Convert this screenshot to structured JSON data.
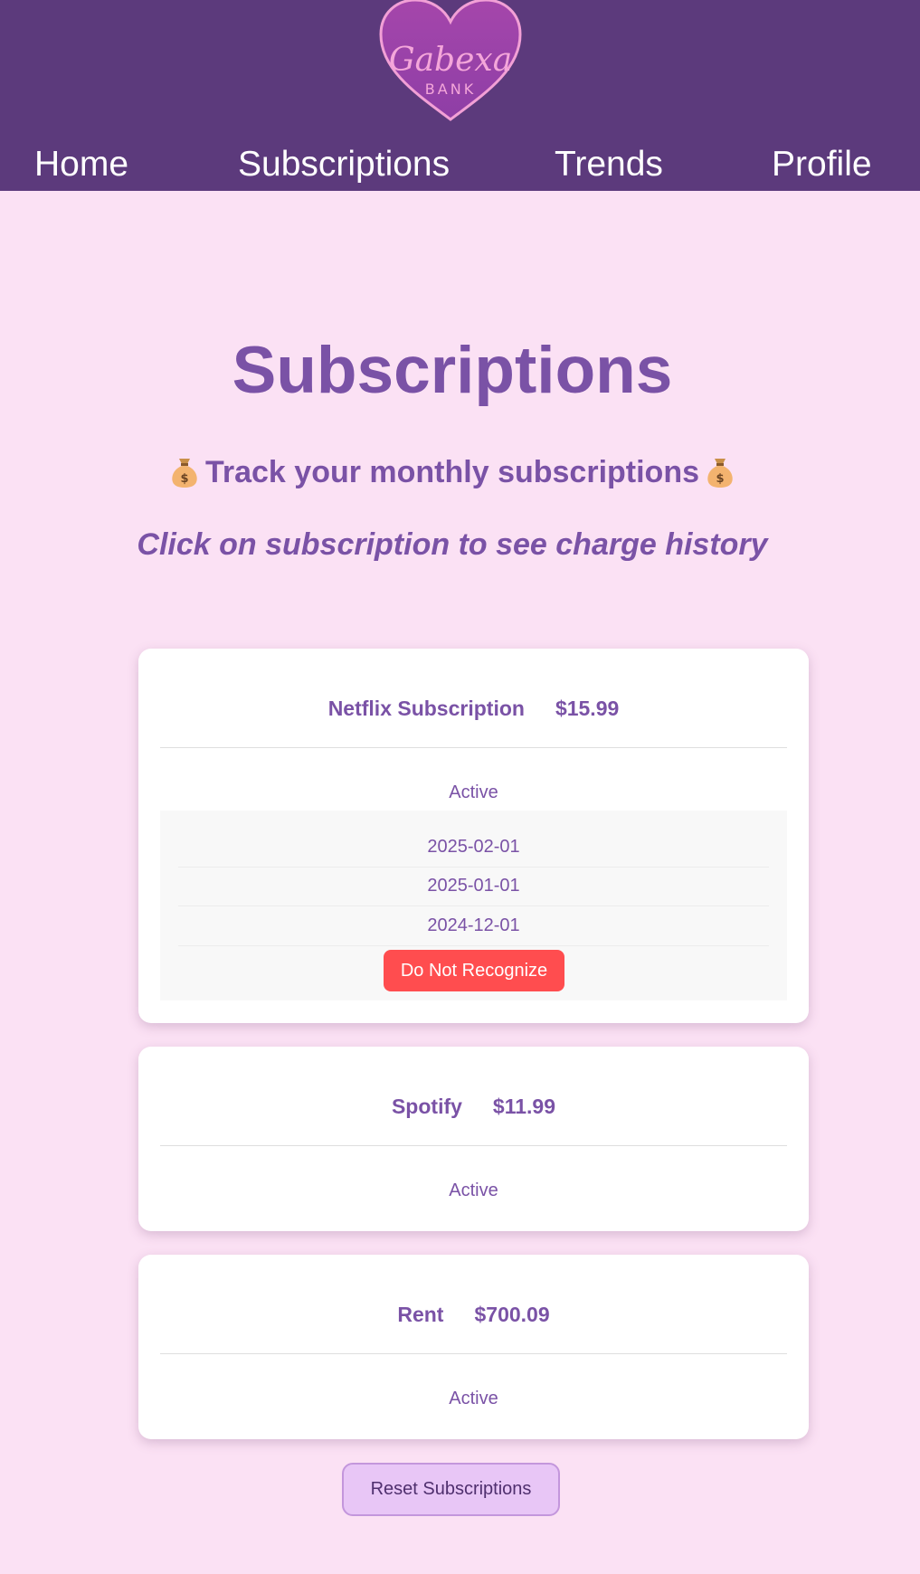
{
  "logo": {
    "line1": "Gabexa",
    "line2": "BANK",
    "icon": "heart-logo-icon"
  },
  "nav": {
    "items": [
      {
        "label": "Home"
      },
      {
        "label": "Subscriptions"
      },
      {
        "label": "Trends"
      },
      {
        "label": "Profile"
      }
    ]
  },
  "main": {
    "title": "Subscriptions",
    "subtitle": "Track your monthly subscriptions",
    "subtitle_icon": "money-bag-icon",
    "instruction": "Click on subscription to see charge history"
  },
  "subscriptions": [
    {
      "name": "Netflix Subscription",
      "amount": "$15.99",
      "status": "Active",
      "expanded": true,
      "history": [
        "2025-02-01",
        "2025-01-01",
        "2024-12-01"
      ],
      "action_label": "Do Not Recognize"
    },
    {
      "name": "Spotify",
      "amount": "$11.99",
      "status": "Active",
      "expanded": false
    },
    {
      "name": "Rent",
      "amount": "$700.09",
      "status": "Active",
      "expanded": false
    }
  ],
  "reset_label": "Reset Subscriptions",
  "colors": {
    "header_bg": "#5c3a7c",
    "page_bg": "#fbe1f4",
    "accent_text": "#7a52a6",
    "danger_button": "#ff4d4f",
    "reset_button_bg": "#e8c6f6"
  }
}
